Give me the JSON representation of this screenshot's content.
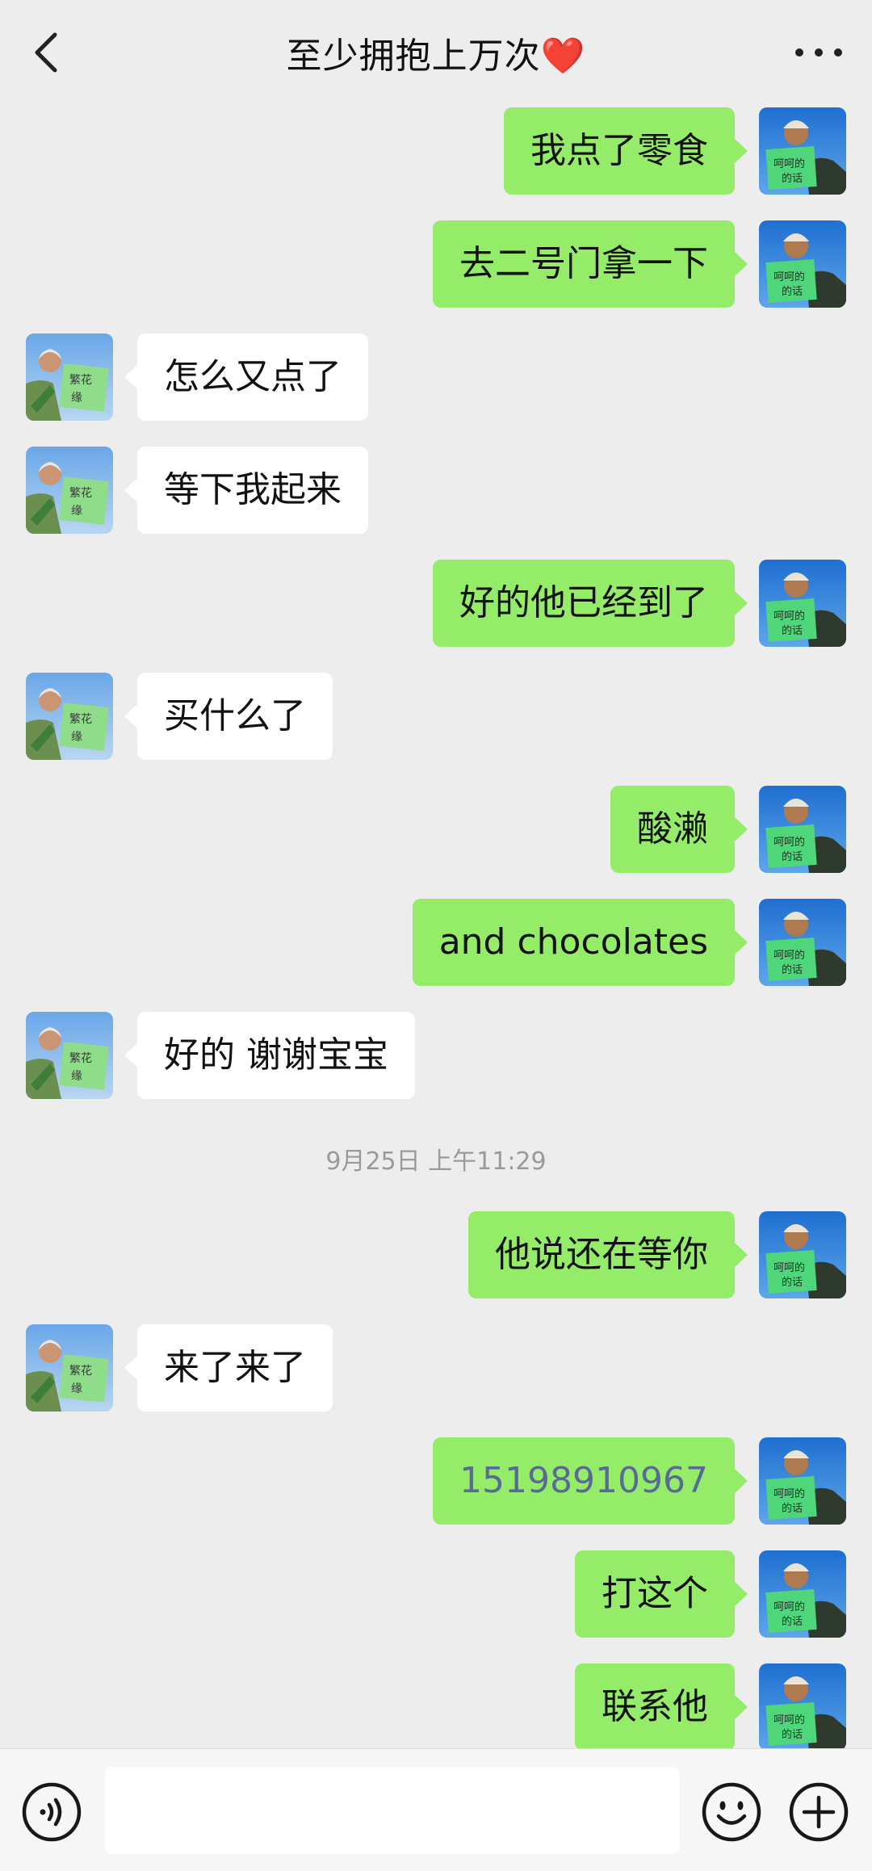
{
  "header": {
    "title": "至少拥抱上万次",
    "title_heart": "❤️",
    "back_icon": "chevron-left-icon",
    "more_icon": "ellipsis-icon"
  },
  "messages": [
    {
      "from": "me",
      "text": "我点了零食"
    },
    {
      "from": "me",
      "text": "去二号门拿一下"
    },
    {
      "from": "other",
      "text": "怎么又点了"
    },
    {
      "from": "other",
      "text": "等下我起来"
    },
    {
      "from": "me",
      "text": "好的他已经到了"
    },
    {
      "from": "other",
      "text": "买什么了"
    },
    {
      "from": "me",
      "text": "酸濑"
    },
    {
      "from": "me",
      "text": "and chocolates"
    },
    {
      "from": "other",
      "text": "好的 谢谢宝宝"
    },
    {
      "from": "me",
      "text": "他说还在等你"
    },
    {
      "from": "other",
      "text": "来了来了"
    },
    {
      "from": "me",
      "text": "15198910967"
    },
    {
      "from": "me",
      "text": "打这个"
    },
    {
      "from": "me",
      "text": "联系他"
    }
  ],
  "timestamp": "9月25日 上午11:29",
  "avatars": {
    "me": {
      "sign_text": "呵呵的话"
    },
    "other": {
      "sign_text": "繁花 缘"
    }
  },
  "input_bar": {
    "voice_icon": "voice-icon",
    "emoji_icon": "emoji-icon",
    "plus_icon": "plus-icon",
    "input_value": ""
  },
  "colors": {
    "background": "#ededed",
    "my_bubble": "#95ec69",
    "other_bubble": "#ffffff",
    "link": "#576b95"
  }
}
